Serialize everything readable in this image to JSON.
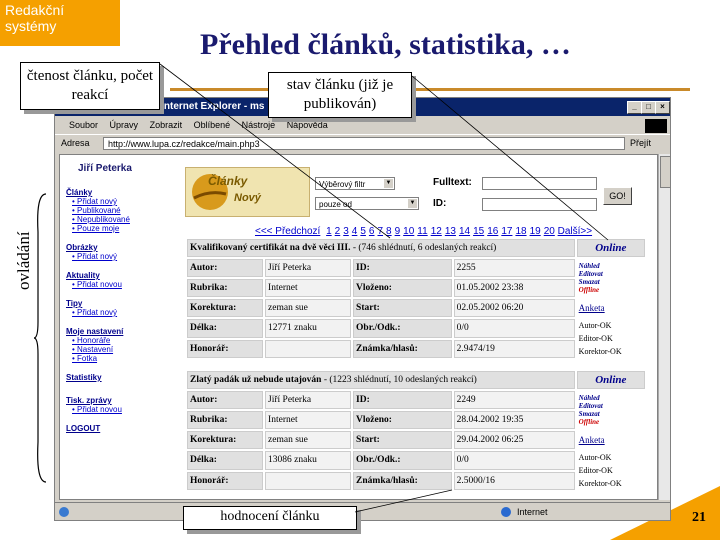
{
  "slide": {
    "corner_tag": "Redakční systémy",
    "title": "Přehled článků, statistika, …",
    "side_label": "ovládání",
    "page_number": "21",
    "callouts": {
      "read": "čtenost článku, počet reakcí",
      "state": "stav článku (již je publikován)",
      "rating": "hodnocení článku"
    }
  },
  "browser": {
    "title": "t Internet Explorer - ms",
    "menu": [
      "Soubor",
      "Úpravy",
      "Zobrazit",
      "Oblíbené",
      "Nástroje",
      "Nápověda"
    ],
    "address_label": "Adresa",
    "address": "http://www.lupa.cz/redakce/main.php3",
    "go_label": "Přejít",
    "status": "Internet",
    "colors": {
      "titlebar": "#0a246a",
      "chrome": "#d4d0c8",
      "accent": "#f5a000"
    }
  },
  "sidebar": {
    "author": "Jiří Peterka",
    "sections": [
      {
        "title": "Články",
        "items": [
          "Přidat nový",
          "Publikované",
          "Nepublikované",
          "Pouze moje"
        ]
      },
      {
        "title": "Obrázky",
        "items": [
          "Přidat nový"
        ]
      },
      {
        "title": "Aktuality",
        "items": [
          "Přidat novou"
        ]
      },
      {
        "title": "Tipy",
        "items": [
          "Přidat nový"
        ]
      },
      {
        "title": "Moje nastavení",
        "items": [
          "Honoráře",
          "Nastavení",
          "Fotka"
        ]
      },
      {
        "title": "Statistiky",
        "items": []
      },
      {
        "title": "Tisk. zprávy",
        "items": [
          "Přidat novou"
        ]
      },
      {
        "title": "LOGOUT",
        "items": []
      }
    ]
  },
  "filters": {
    "logo_line1": "Články",
    "logo_line2": "Nový",
    "select1": "Výběrový filtr",
    "select2": "pouze od",
    "fulltext_label": "Fulltext:",
    "id_label": "ID:",
    "go_button": "GO!"
  },
  "pager": {
    "prev": "<<< Předchozí",
    "pages": [
      "1",
      "2",
      "3",
      "4",
      "5",
      "6",
      "7",
      "8",
      "9",
      "10",
      "11",
      "12",
      "13",
      "14",
      "15",
      "16",
      "17",
      "18",
      "19",
      "20"
    ],
    "next": "Další>>"
  },
  "articles": [
    {
      "headline": "Kvalifikovaný certifikát na dvě věci III.",
      "stats": " - (746 shlédnutí, 6 odeslaných reakcí)",
      "status": "Online",
      "actions": [
        "Náhled",
        "Editovat",
        "Smazat",
        "Offline"
      ],
      "survey": "Anketa",
      "checks": [
        "Autor-OK",
        "Editor-OK",
        "Korektor-OK"
      ],
      "labels": [
        "Autor:",
        "Rubrika:",
        "Korektura:",
        "Délka:",
        "Honorář:"
      ],
      "values": [
        "Jiří Peterka",
        "Internet",
        "zeman sue",
        "12771 znaku",
        ""
      ],
      "labels2": [
        "ID:",
        "Vloženo:",
        "Start:",
        "Obr./Odk.:",
        "Známka/hlasů:"
      ],
      "values2": [
        "2255",
        "01.05.2002 23:38",
        "02.05.2002 06:20",
        "0/0",
        "2.9474/19"
      ]
    },
    {
      "headline": "Zlatý padák už nebude utajován",
      "stats": " - (1223 shlédnutí, 10 odeslaných reakcí)",
      "status": "Online",
      "actions": [
        "Náhled",
        "Editovat",
        "Smazat",
        "Offline"
      ],
      "survey": "Anketa",
      "checks": [
        "Autor-OK",
        "Editor-OK",
        "Korektor-OK"
      ],
      "labels": [
        "Autor:",
        "Rubrika:",
        "Korektura:",
        "Délka:",
        "Honorář:"
      ],
      "values": [
        "Jiří Peterka",
        "Internet",
        "zeman sue",
        "13086 znaku",
        ""
      ],
      "labels2": [
        "ID:",
        "Vloženo:",
        "Start:",
        "Obr./Odk.:",
        "Známka/hlasů:"
      ],
      "values2": [
        "2249",
        "28.04.2002 19:35",
        "29.04.2002 06:25",
        "0/0",
        "2.5000/16"
      ]
    }
  ]
}
